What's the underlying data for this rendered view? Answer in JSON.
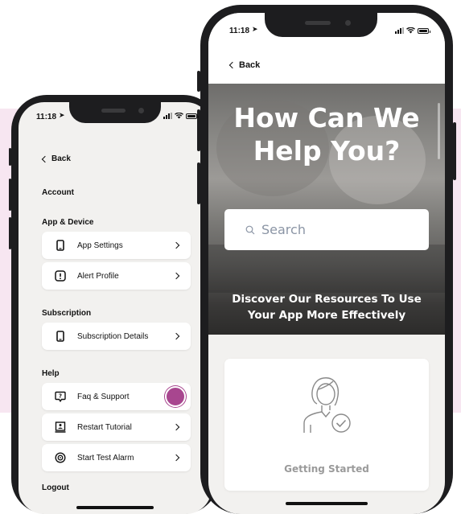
{
  "colors": {
    "accent": "#a8468f",
    "background_band": "#f7e6f1",
    "screen_bg": "#f2f1ef"
  },
  "left_phone": {
    "status_time": "11:18",
    "back_label": "Back",
    "sections": [
      {
        "label": "Account",
        "items": []
      },
      {
        "label": "App & Device",
        "items": [
          {
            "label": "App Settings",
            "icon": "phone-icon"
          },
          {
            "label": "Alert Profile",
            "icon": "alert-icon"
          }
        ]
      },
      {
        "label": "Subscription",
        "items": [
          {
            "label": "Subscription Details",
            "icon": "phone-icon"
          }
        ]
      },
      {
        "label": "Help",
        "items": [
          {
            "label": "Faq & Support",
            "icon": "chat-question-icon"
          },
          {
            "label": "Restart Tutorial",
            "icon": "tutorial-icon"
          },
          {
            "label": "Start Test Alarm",
            "icon": "alarm-icon"
          }
        ]
      }
    ],
    "logout_label": "Logout"
  },
  "right_phone": {
    "status_time": "11:18",
    "back_label": "Back",
    "hero_title_line1": "How Can We",
    "hero_title_line2": "Help You?",
    "search_placeholder": "Search",
    "hero_subtitle_line1": "Discover Our Resources To Use",
    "hero_subtitle_line2": "Your App More Effectively",
    "card_label": "Getting Started",
    "card_icon": "person-check-icon"
  }
}
